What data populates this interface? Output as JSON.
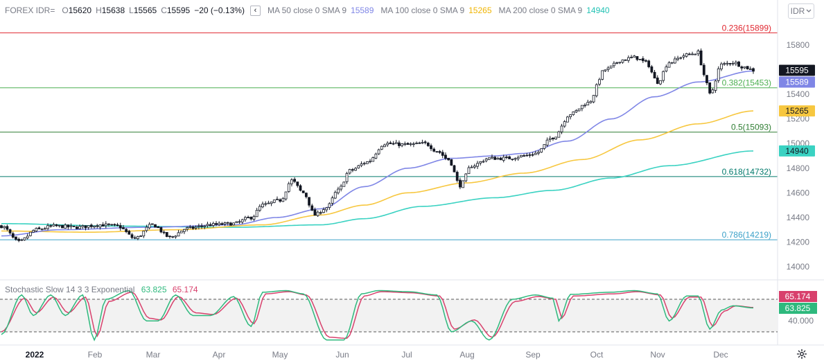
{
  "header": {
    "symbol": "FOREX IDR=",
    "open_label": "O",
    "open": "15620",
    "high_label": "H",
    "high": "15638",
    "low_label": "L",
    "low": "15565",
    "close_label": "C",
    "close": "15595",
    "change": "−20 (−0.13%)",
    "collapse_glyph": "‹",
    "ma50_label": "MA 50 close 0 SMA 9",
    "ma50_value": "15589",
    "ma100_label": "MA 100 close 0 SMA 9",
    "ma100_value": "15265",
    "ma200_label": "MA 200 close 0 SMA 9",
    "ma200_value": "14940"
  },
  "currency_button": {
    "label": "IDR",
    "icon": "chevron-down-icon"
  },
  "stochastic": {
    "label": "Stochastic Slow 14 3 3 Exponential",
    "k_value": "63.825",
    "d_value": "65.174",
    "level_label": "40.000"
  },
  "settings_icon": "gear-icon",
  "colors": {
    "ma50": "#7f86e6",
    "ma100": "#f7c73f",
    "ma200": "#3ad2c2",
    "stoch_k": "#2eb97d",
    "stoch_d": "#d8406c",
    "fib_0236": "#e0262f",
    "fib_0382": "#4caf50",
    "fib_05": "#2e7d32",
    "fib_0618": "#00796b",
    "fib_0786": "#3aa0c8"
  },
  "chart_data": {
    "type": "candlestick",
    "ylim": [
      13900,
      15980
    ],
    "y_ticks": [
      "15800",
      "15600",
      "15400",
      "15200",
      "15000",
      "14800",
      "14600",
      "14400",
      "14200",
      "14000"
    ],
    "x_labels": [
      "2022",
      "Feb",
      "Mar",
      "Apr",
      "May",
      "Jun",
      "Jul",
      "Aug",
      "Sep",
      "Oct",
      "Nov",
      "Dec"
    ],
    "fib_levels": [
      {
        "ratio": "0.236",
        "value": 15899,
        "label": "0.236(15899)"
      },
      {
        "ratio": "0.382",
        "value": 15453,
        "label": "0.382(15453)"
      },
      {
        "ratio": "0.5",
        "value": 15093,
        "label": "0.5(15093)"
      },
      {
        "ratio": "0.618",
        "value": 14732,
        "label": "0.618(14732)"
      },
      {
        "ratio": "0.786",
        "value": 14219,
        "label": "0.786(14219)"
      }
    ],
    "price_tags": [
      {
        "name": "last-price",
        "value": 15595,
        "label": "15595"
      },
      {
        "name": "ma50",
        "value": 15589,
        "label": "15589"
      },
      {
        "name": "ma100",
        "value": 15265,
        "label": "15265"
      },
      {
        "name": "ma200",
        "value": 14940,
        "label": "14940"
      }
    ],
    "close_anchors": [
      [
        0,
        14330
      ],
      [
        6,
        14200
      ],
      [
        12,
        14300
      ],
      [
        18,
        14330
      ],
      [
        26,
        14320
      ],
      [
        34,
        14340
      ],
      [
        40,
        14330
      ],
      [
        46,
        14230
      ],
      [
        52,
        14340
      ],
      [
        58,
        14240
      ],
      [
        64,
        14310
      ],
      [
        72,
        14340
      ],
      [
        80,
        14350
      ],
      [
        86,
        14400
      ],
      [
        90,
        14500
      ],
      [
        96,
        14540
      ],
      [
        100,
        14700
      ],
      [
        104,
        14600
      ],
      [
        108,
        14420
      ],
      [
        112,
        14480
      ],
      [
        116,
        14620
      ],
      [
        120,
        14780
      ],
      [
        126,
        14850
      ],
      [
        132,
        15000
      ],
      [
        140,
        14990
      ],
      [
        146,
        15000
      ],
      [
        150,
        14940
      ],
      [
        154,
        14870
      ],
      [
        158,
        14660
      ],
      [
        162,
        14820
      ],
      [
        168,
        14880
      ],
      [
        174,
        14880
      ],
      [
        180,
        14900
      ],
      [
        184,
        14920
      ],
      [
        190,
        15050
      ],
      [
        196,
        15240
      ],
      [
        202,
        15330
      ],
      [
        208,
        15600
      ],
      [
        214,
        15680
      ],
      [
        218,
        15700
      ],
      [
        222,
        15660
      ],
      [
        226,
        15500
      ],
      [
        230,
        15660
      ],
      [
        236,
        15720
      ],
      [
        240,
        15740
      ],
      [
        242,
        15560
      ],
      [
        244,
        15400
      ],
      [
        248,
        15640
      ],
      [
        252,
        15660
      ],
      [
        256,
        15620
      ],
      [
        259,
        15595
      ]
    ],
    "ma50_anchors": [
      [
        0,
        14250
      ],
      [
        20,
        14300
      ],
      [
        50,
        14320
      ],
      [
        80,
        14340
      ],
      [
        95,
        14400
      ],
      [
        110,
        14470
      ],
      [
        125,
        14650
      ],
      [
        140,
        14800
      ],
      [
        155,
        14880
      ],
      [
        170,
        14900
      ],
      [
        180,
        14920
      ],
      [
        195,
        15020
      ],
      [
        210,
        15200
      ],
      [
        225,
        15380
      ],
      [
        240,
        15500
      ],
      [
        259,
        15589
      ]
    ],
    "ma100_anchors": [
      [
        0,
        14290
      ],
      [
        30,
        14280
      ],
      [
        60,
        14300
      ],
      [
        90,
        14340
      ],
      [
        110,
        14420
      ],
      [
        125,
        14500
      ],
      [
        140,
        14600
      ],
      [
        160,
        14680
      ],
      [
        180,
        14760
      ],
      [
        200,
        14870
      ],
      [
        220,
        15030
      ],
      [
        240,
        15160
      ],
      [
        259,
        15265
      ]
    ],
    "ma200_anchors": [
      [
        0,
        14350
      ],
      [
        40,
        14330
      ],
      [
        80,
        14320
      ],
      [
        110,
        14340
      ],
      [
        125,
        14390
      ],
      [
        145,
        14490
      ],
      [
        170,
        14560
      ],
      [
        190,
        14620
      ],
      [
        210,
        14720
      ],
      [
        230,
        14820
      ],
      [
        259,
        14940
      ]
    ],
    "stoch_k_anchors": [
      [
        0,
        15
      ],
      [
        7,
        88
      ],
      [
        11,
        50
      ],
      [
        17,
        88
      ],
      [
        22,
        50
      ],
      [
        28,
        88
      ],
      [
        32,
        5
      ],
      [
        36,
        80
      ],
      [
        44,
        96
      ],
      [
        50,
        40
      ],
      [
        54,
        40
      ],
      [
        60,
        88
      ],
      [
        66,
        50
      ],
      [
        72,
        50
      ],
      [
        80,
        85
      ],
      [
        86,
        30
      ],
      [
        90,
        93
      ],
      [
        98,
        96
      ],
      [
        104,
        90
      ],
      [
        112,
        5
      ],
      [
        118,
        5
      ],
      [
        124,
        90
      ],
      [
        130,
        96
      ],
      [
        140,
        94
      ],
      [
        150,
        88
      ],
      [
        155,
        20
      ],
      [
        162,
        40
      ],
      [
        168,
        5
      ],
      [
        176,
        80
      ],
      [
        184,
        88
      ],
      [
        190,
        82
      ],
      [
        192,
        40
      ],
      [
        196,
        89
      ],
      [
        210,
        93
      ],
      [
        218,
        96
      ],
      [
        226,
        90
      ],
      [
        230,
        40
      ],
      [
        236,
        86
      ],
      [
        240,
        86
      ],
      [
        244,
        25
      ],
      [
        248,
        60
      ],
      [
        252,
        68
      ],
      [
        259,
        64
      ]
    ],
    "stoch_d_anchors": [
      [
        0,
        20
      ],
      [
        8,
        82
      ],
      [
        12,
        55
      ],
      [
        18,
        84
      ],
      [
        23,
        55
      ],
      [
        29,
        84
      ],
      [
        33,
        12
      ],
      [
        37,
        76
      ],
      [
        45,
        93
      ],
      [
        51,
        45
      ],
      [
        55,
        42
      ],
      [
        61,
        85
      ],
      [
        67,
        55
      ],
      [
        73,
        52
      ],
      [
        81,
        82
      ],
      [
        87,
        35
      ],
      [
        91,
        90
      ],
      [
        99,
        94
      ],
      [
        105,
        88
      ],
      [
        113,
        10
      ],
      [
        119,
        8
      ],
      [
        125,
        86
      ],
      [
        131,
        94
      ],
      [
        141,
        92
      ],
      [
        151,
        86
      ],
      [
        156,
        25
      ],
      [
        163,
        42
      ],
      [
        169,
        10
      ],
      [
        177,
        76
      ],
      [
        185,
        85
      ],
      [
        191,
        80
      ],
      [
        193,
        45
      ],
      [
        197,
        86
      ],
      [
        211,
        90
      ],
      [
        219,
        94
      ],
      [
        227,
        88
      ],
      [
        231,
        45
      ],
      [
        237,
        84
      ],
      [
        241,
        84
      ],
      [
        245,
        30
      ],
      [
        249,
        58
      ],
      [
        253,
        68
      ],
      [
        259,
        65
      ]
    ],
    "stoch_ylim": [
      0,
      100
    ],
    "stoch_levels": [
      80,
      20
    ]
  }
}
